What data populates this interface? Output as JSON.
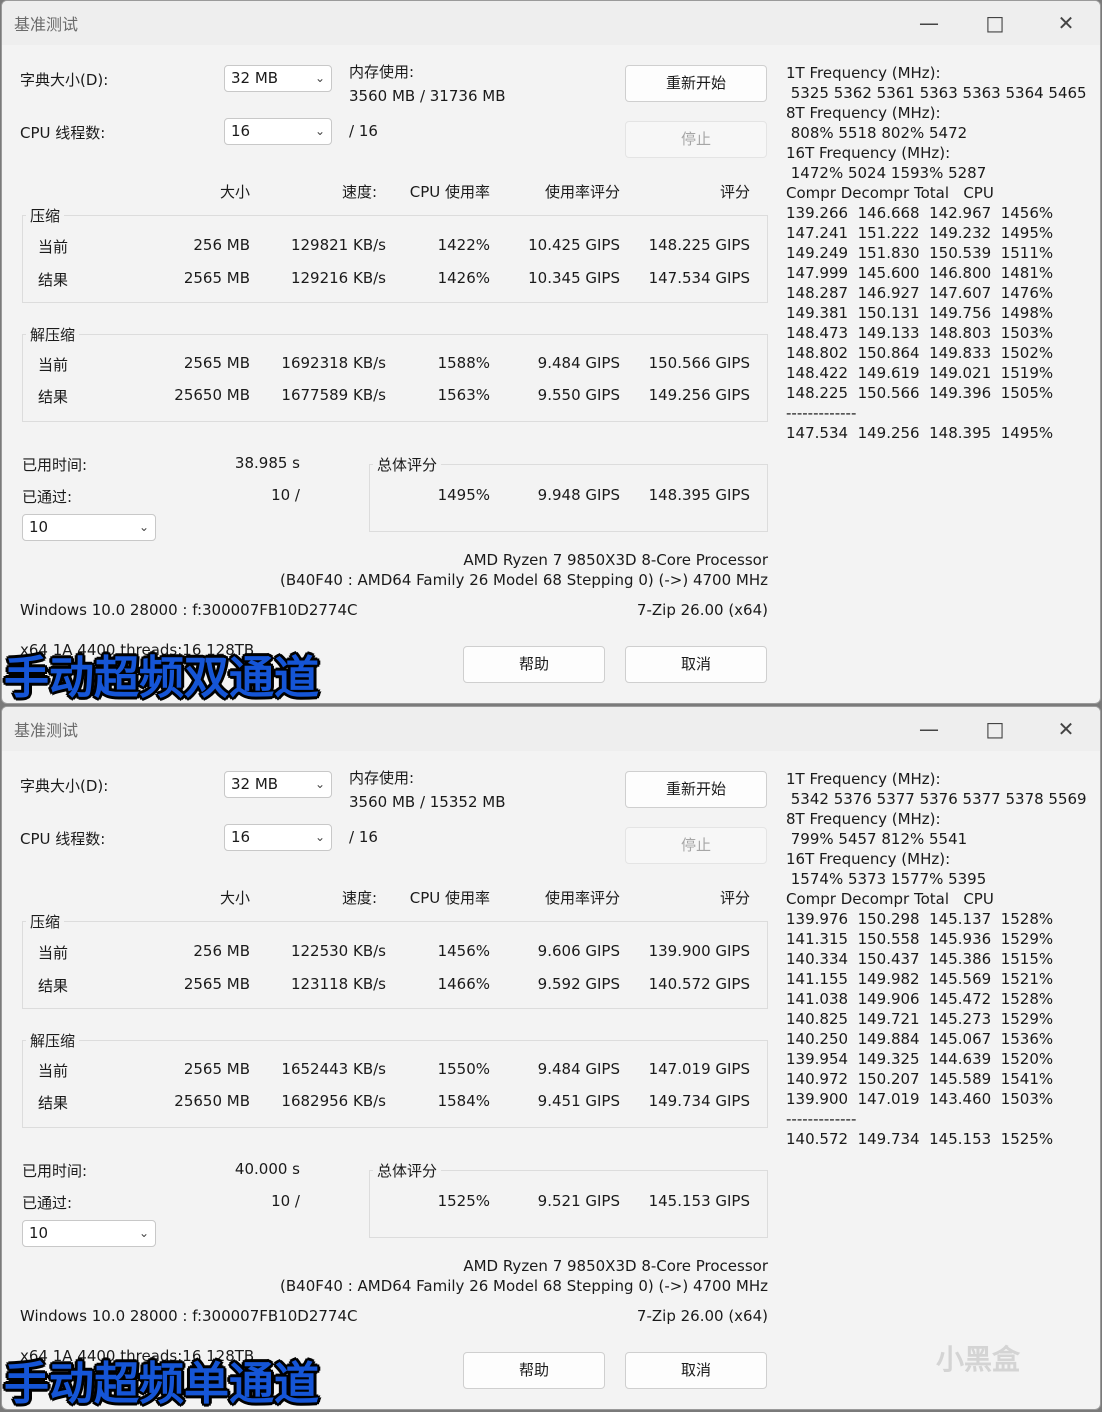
{
  "windows": [
    {
      "title": "基准测试",
      "dict_label": "字典大小(D):",
      "dict_value": "32 MB",
      "threads_label": "CPU 线程数:",
      "threads_value": "16",
      "threads_max": "/ 16",
      "mem_label": "内存使用:",
      "mem_value": "3560 MB / 31736 MB",
      "restart_label": "重新开始",
      "stop_label": "停止",
      "col_headers": [
        "大小",
        "速度:",
        "CPU 使用率",
        "使用率评分",
        "评分"
      ],
      "compress_label": "压缩",
      "decompress_label": "解压缩",
      "current_label": "当前",
      "result_label": "结果",
      "compress_current": [
        "256 MB",
        "129821 KB/s",
        "1422%",
        "10.425 GIPS",
        "148.225 GIPS"
      ],
      "compress_result": [
        "2565 MB",
        "129216 KB/s",
        "1426%",
        "10.345 GIPS",
        "147.534 GIPS"
      ],
      "decompress_current": [
        "2565 MB",
        "1692318 KB/s",
        "1588%",
        "9.484 GIPS",
        "150.566 GIPS"
      ],
      "decompress_result": [
        "25650 MB",
        "1677589 KB/s",
        "1563%",
        "9.550 GIPS",
        "149.256 GIPS"
      ],
      "elapsed_label": "已用时间:",
      "elapsed_value": "38.985 s",
      "passed_label": "已通过:",
      "passed_value": "10 /",
      "passes_combo": "10",
      "total_label": "总体评分",
      "total_values": [
        "1495%",
        "9.948 GIPS",
        "148.395 GIPS"
      ],
      "cpu_name": "AMD Ryzen 7 9850X3D 8-Core Processor",
      "cpu_detail": "(B40F40 : AMD64 Family 26 Model 68 Stepping 0) (->) 4700 MHz",
      "os_info": "Windows 10.0 28000 :  f:300007FB10D2774C",
      "app_version": "7-Zip 26.00 (x64)",
      "build_info": "x64 1A 4400 threads:16 128TB",
      "help_label": "帮助",
      "cancel_label": "取消",
      "side": [
        "1T Frequency (MHz):",
        " 5325 5362 5361 5363 5363 5364 5465",
        "8T Frequency (MHz):",
        " 808% 5518 802% 5472",
        "16T Frequency (MHz):",
        " 1472% 5024 1593% 5287",
        "Compr Decompr Total   CPU",
        "139.266  146.668  142.967  1456%",
        "147.241  151.222  149.232  1495%",
        "149.249  151.830  150.539  1511%",
        "147.999  145.600  146.800  1481%",
        "148.287  146.927  147.607  1476%",
        "149.381  150.131  149.756  1498%",
        "148.473  149.133  148.803  1503%",
        "148.802  150.864  149.833  1502%",
        "148.422  149.619  149.021  1519%",
        "148.225  150.566  149.396  1505%",
        "-------------",
        "147.534  149.256  148.395  1495%"
      ],
      "banner": "手动超频双通道"
    },
    {
      "title": "基准测试",
      "dict_label": "字典大小(D):",
      "dict_value": "32 MB",
      "threads_label": "CPU 线程数:",
      "threads_value": "16",
      "threads_max": "/ 16",
      "mem_label": "内存使用:",
      "mem_value": "3560 MB / 15352 MB",
      "restart_label": "重新开始",
      "stop_label": "停止",
      "col_headers": [
        "大小",
        "速度:",
        "CPU 使用率",
        "使用率评分",
        "评分"
      ],
      "compress_label": "压缩",
      "decompress_label": "解压缩",
      "current_label": "当前",
      "result_label": "结果",
      "compress_current": [
        "256 MB",
        "122530 KB/s",
        "1456%",
        "9.606 GIPS",
        "139.900 GIPS"
      ],
      "compress_result": [
        "2565 MB",
        "123118 KB/s",
        "1466%",
        "9.592 GIPS",
        "140.572 GIPS"
      ],
      "decompress_current": [
        "2565 MB",
        "1652443 KB/s",
        "1550%",
        "9.484 GIPS",
        "147.019 GIPS"
      ],
      "decompress_result": [
        "25650 MB",
        "1682956 KB/s",
        "1584%",
        "9.451 GIPS",
        "149.734 GIPS"
      ],
      "elapsed_label": "已用时间:",
      "elapsed_value": "40.000 s",
      "passed_label": "已通过:",
      "passed_value": "10 /",
      "passes_combo": "10",
      "total_label": "总体评分",
      "total_values": [
        "1525%",
        "9.521 GIPS",
        "145.153 GIPS"
      ],
      "cpu_name": "AMD Ryzen 7 9850X3D 8-Core Processor",
      "cpu_detail": "(B40F40 : AMD64 Family 26 Model 68 Stepping 0) (->) 4700 MHz",
      "os_info": "Windows 10.0 28000 :  f:300007FB10D2774C",
      "app_version": "7-Zip 26.00 (x64)",
      "build_info": "x64 1A 4400 threads:16 128TB",
      "help_label": "帮助",
      "cancel_label": "取消",
      "side": [
        "1T Frequency (MHz):",
        " 5342 5376 5377 5376 5377 5378 5569",
        "8T Frequency (MHz):",
        " 799% 5457 812% 5541",
        "16T Frequency (MHz):",
        " 1574% 5373 1577% 5395",
        "Compr Decompr Total   CPU",
        "139.976  150.298  145.137  1528%",
        "141.315  150.558  145.936  1529%",
        "140.334  150.437  145.386  1515%",
        "141.155  149.982  145.569  1521%",
        "141.038  149.906  145.472  1528%",
        "140.825  149.721  145.273  1529%",
        "140.250  149.884  145.067  1536%",
        "139.954  149.325  144.639  1520%",
        "140.972  150.207  145.589  1541%",
        "139.900  147.019  143.460  1503%",
        "-------------",
        "140.572  149.734  145.153  1525%"
      ],
      "banner": "手动超频单通道"
    }
  ],
  "watermark": "小黑盒"
}
